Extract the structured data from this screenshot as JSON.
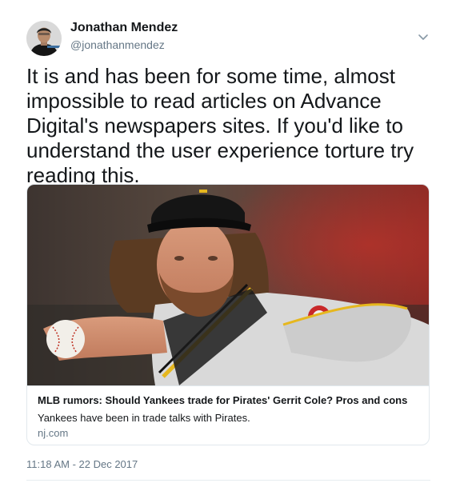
{
  "author": {
    "name": "Jonathan Mendez",
    "handle": "@jonathanmendez"
  },
  "tweet": {
    "text": "It is and has been for some time, almost\nimpossible to read articles on Advance\nDigital's newspapers sites. If you'd like to\nunderstand the user experience torture try\nreading this.",
    "timestamp": "11:18 AM - 22 Dec 2017"
  },
  "card": {
    "title": "MLB rumors: Should Yankees trade for Pirates' Gerrit Cole? Pros and cons",
    "description": "Yankees have been in trade talks with Pirates.",
    "domain": "nj.com"
  },
  "icons": {
    "menu": "chevron-down-icon",
    "avatar": "avatar-photo"
  },
  "colors": {
    "text": "#14171a",
    "secondary": "#657786",
    "border": "#e1e8ed"
  }
}
